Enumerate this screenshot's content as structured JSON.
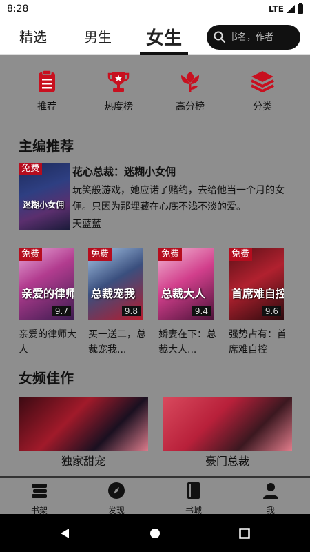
{
  "status_bar": {
    "time": "8:28",
    "network": "LTE"
  },
  "tabs": [
    {
      "label": "精选"
    },
    {
      "label": "男生"
    },
    {
      "label": "女生"
    }
  ],
  "search": {
    "placeholder": "书名，作者"
  },
  "categories": [
    {
      "label": "推荐",
      "icon": "clipboard-icon"
    },
    {
      "label": "热度榜",
      "icon": "trophy-icon"
    },
    {
      "label": "高分榜",
      "icon": "flower-icon"
    },
    {
      "label": "分类",
      "icon": "layers-icon"
    }
  ],
  "editor_section": {
    "title": "主编推荐",
    "featured": {
      "badge": "免费",
      "cover_text": "迷糊小女佣",
      "title": "花心总裁：迷糊小女佣",
      "description": "玩笑般游戏，她应诺了赌约，去给他当一个月的女佣。只因为那埋藏在心底不浅不淡的爱。",
      "author": "天蓝蓝"
    },
    "books": [
      {
        "badge": "免费",
        "cover_text": "亲爱的律师",
        "score": "9.7",
        "title": "亲爱的律师大人"
      },
      {
        "badge": "免费",
        "cover_text": "总裁宠我",
        "score": "9.8",
        "title": "买一送二，总裁宠我..."
      },
      {
        "badge": "免费",
        "cover_text": "总裁大人",
        "score": "9.4",
        "title": "娇妻在下：总裁大人..."
      },
      {
        "badge": "免费",
        "cover_text": "首席难自控",
        "score": "9.6",
        "title": "强势占有：首席难自控"
      }
    ]
  },
  "female_section": {
    "title": "女频佳作",
    "banners": [
      {
        "label": "独家甜宠"
      },
      {
        "label": "豪门总裁"
      }
    ]
  },
  "bottom_nav": [
    {
      "label": "书架",
      "icon": "bookshelf-icon"
    },
    {
      "label": "发现",
      "icon": "compass-icon"
    },
    {
      "label": "书城",
      "icon": "book-icon"
    },
    {
      "label": "我",
      "icon": "person-icon"
    }
  ],
  "colors": {
    "accent_red": "#c8101f",
    "background": "#8e8e8e",
    "badge_red": "#b50d1e"
  }
}
